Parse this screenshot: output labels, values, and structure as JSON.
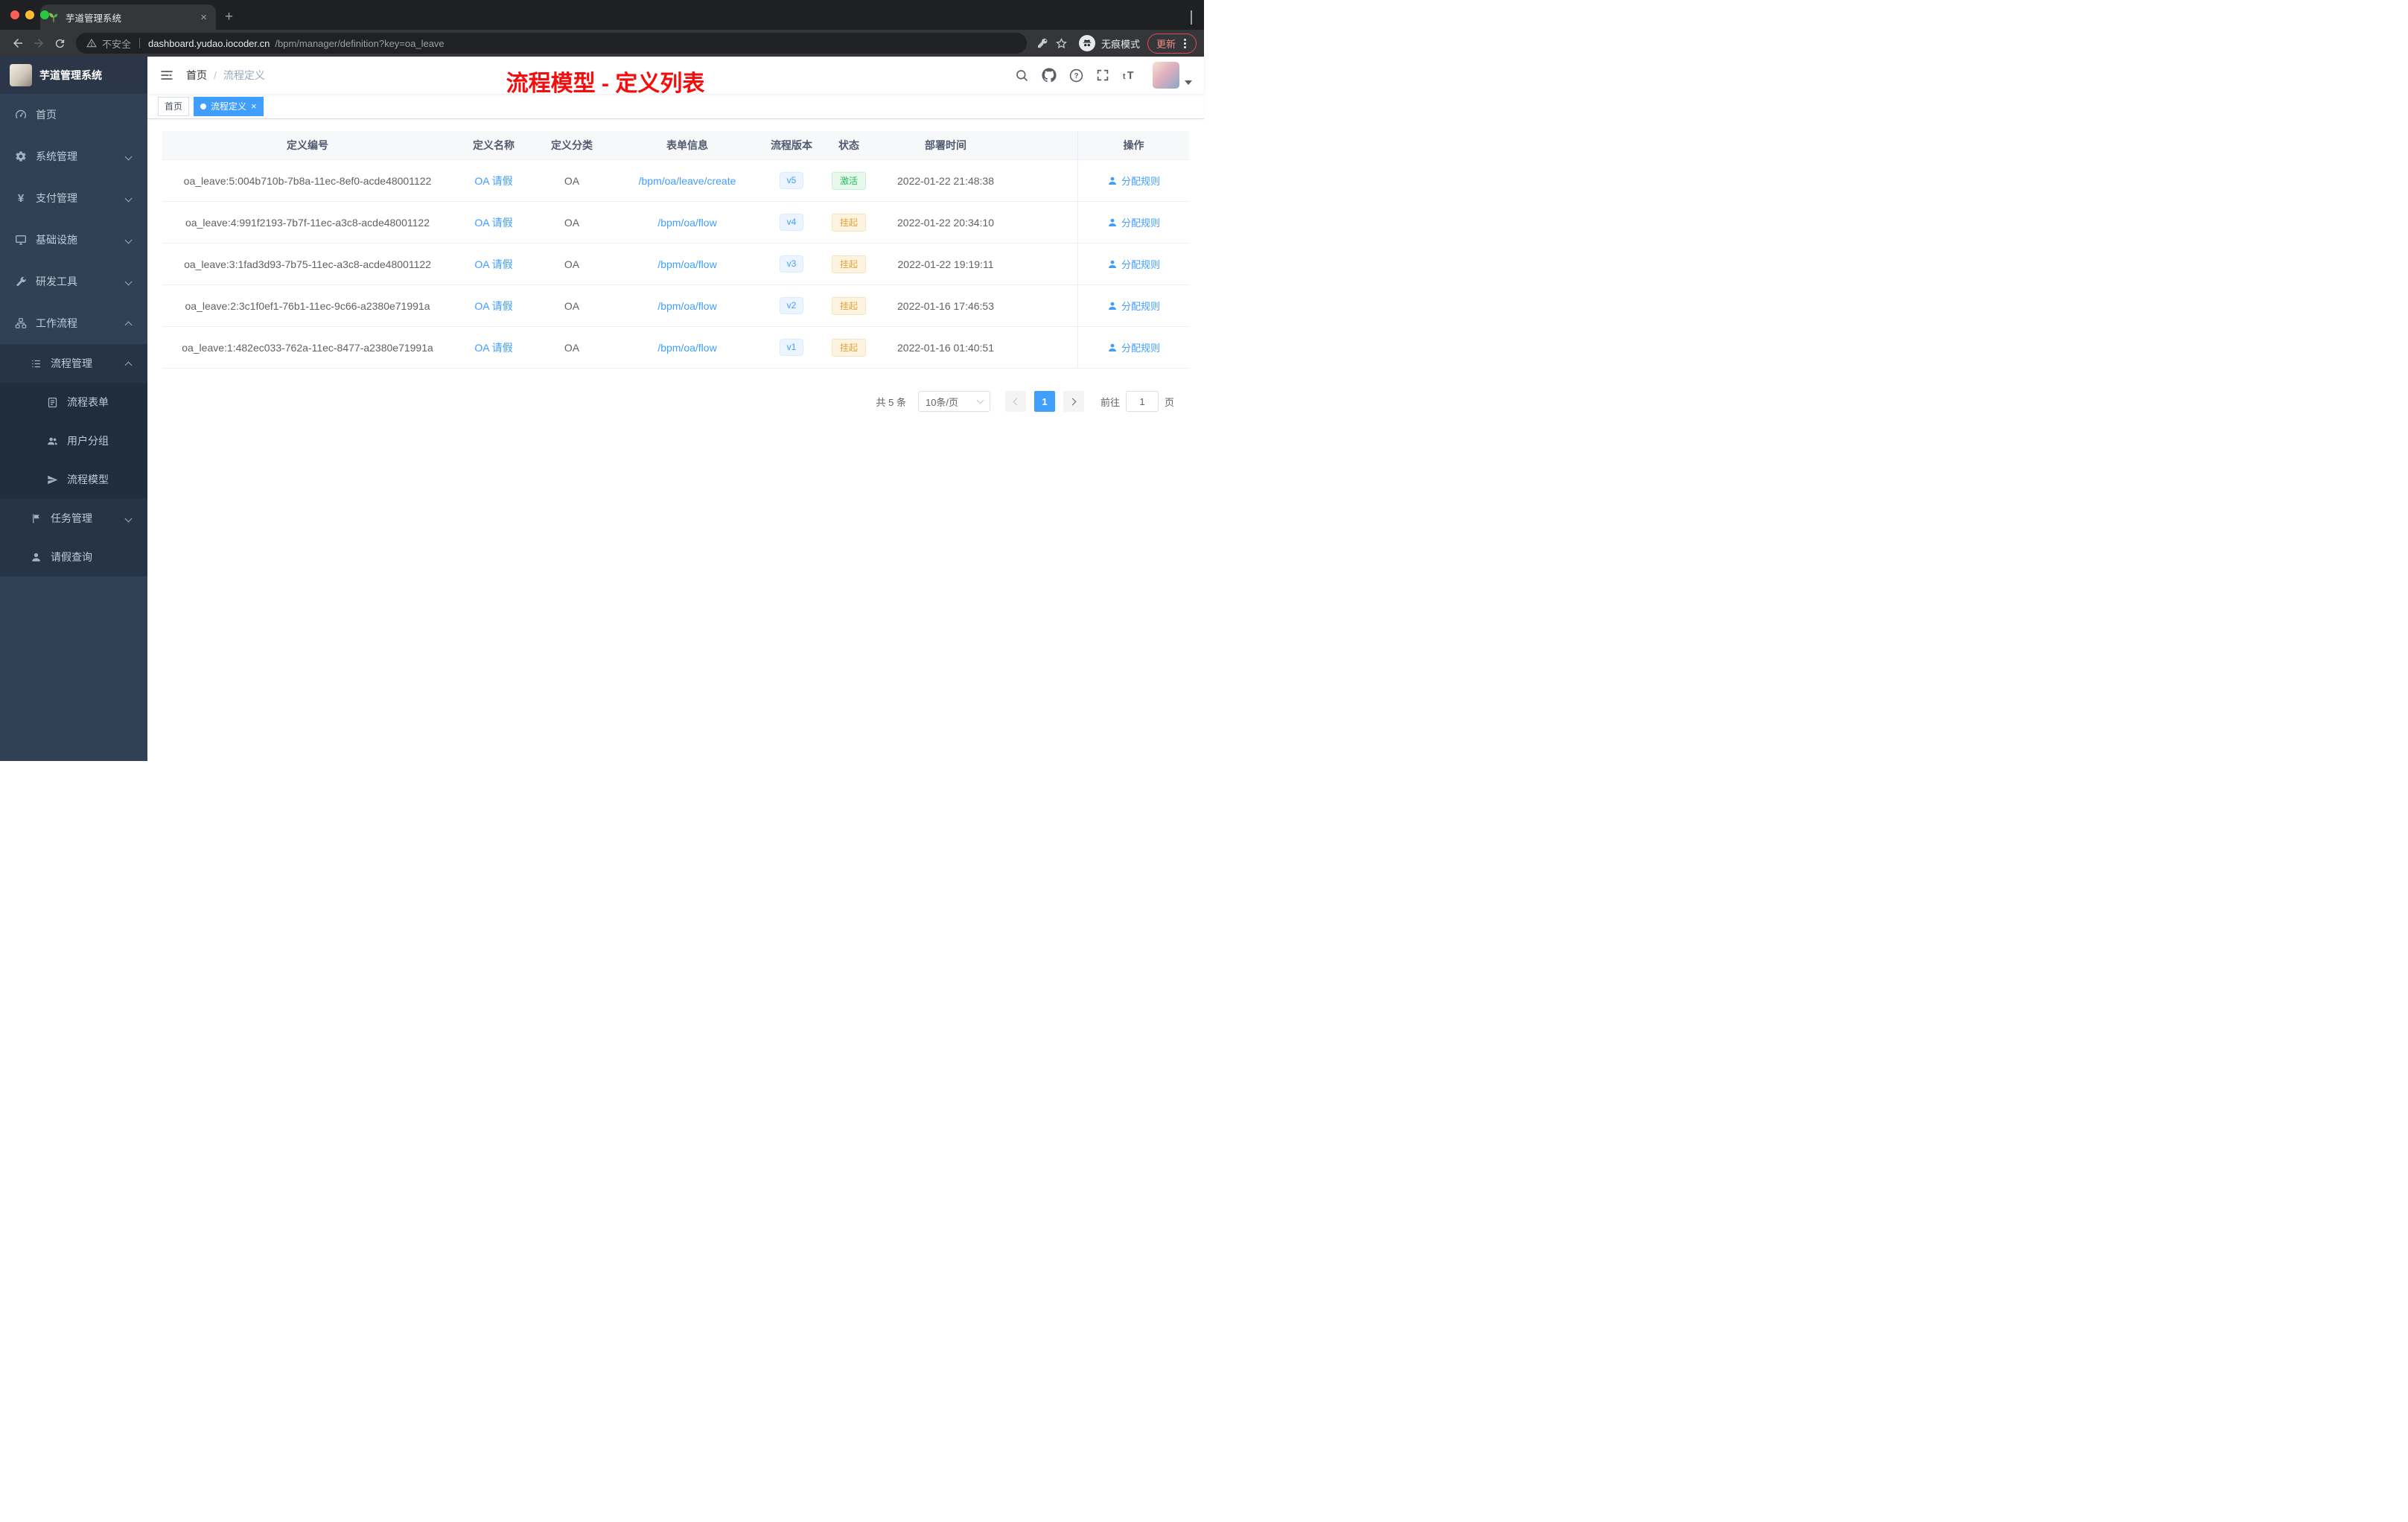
{
  "browser": {
    "tab": {
      "title": "芋道管理系统"
    },
    "address": {
      "security_label": "不安全",
      "host": "dashboard.yudao.iocoder.cn",
      "path": "/bpm/manager/definition?key=oa_leave"
    },
    "incognito_label": "无痕模式",
    "update_label": "更新"
  },
  "sidebar": {
    "logo_title": "芋道管理系统",
    "items": [
      {
        "label": "首页"
      },
      {
        "label": "系统管理"
      },
      {
        "label": "支付管理"
      },
      {
        "label": "基础设施"
      },
      {
        "label": "研发工具"
      },
      {
        "label": "工作流程"
      },
      {
        "label": "流程管理"
      },
      {
        "label": "流程表单"
      },
      {
        "label": "用户分组"
      },
      {
        "label": "流程模型"
      },
      {
        "label": "任务管理"
      },
      {
        "label": "请假查询"
      }
    ]
  },
  "navbar": {
    "breadcrumb_home": "首页",
    "breadcrumb_sep": "/",
    "breadcrumb_current": "流程定义"
  },
  "annotation": {
    "title": "流程模型 - 定义列表"
  },
  "tags": [
    {
      "label": "首页",
      "active": false
    },
    {
      "label": "流程定义",
      "active": true
    }
  ],
  "table": {
    "columns": [
      "定义编号",
      "定义名称",
      "定义分类",
      "表单信息",
      "流程版本",
      "状态",
      "部署时间",
      "操作"
    ],
    "rows": [
      {
        "id": "oa_leave:5:004b710b-7b8a-11ec-8ef0-acde48001122",
        "name": "OA 请假",
        "category": "OA",
        "form": "/bpm/oa/leave/create",
        "version": "v5",
        "status": "激活",
        "status_type": "success",
        "deployed_at": "2022-01-22 21:48:38",
        "action": "分配规则"
      },
      {
        "id": "oa_leave:4:991f2193-7b7f-11ec-a3c8-acde48001122",
        "name": "OA 请假",
        "category": "OA",
        "form": "/bpm/oa/flow",
        "version": "v4",
        "status": "挂起",
        "status_type": "warning",
        "deployed_at": "2022-01-22 20:34:10",
        "action": "分配规则"
      },
      {
        "id": "oa_leave:3:1fad3d93-7b75-11ec-a3c8-acde48001122",
        "name": "OA 请假",
        "category": "OA",
        "form": "/bpm/oa/flow",
        "version": "v3",
        "status": "挂起",
        "status_type": "warning",
        "deployed_at": "2022-01-22 19:19:11",
        "action": "分配规则"
      },
      {
        "id": "oa_leave:2:3c1f0ef1-76b1-11ec-9c66-a2380e71991a",
        "name": "OA 请假",
        "category": "OA",
        "form": "/bpm/oa/flow",
        "version": "v2",
        "status": "挂起",
        "status_type": "warning",
        "deployed_at": "2022-01-16 17:46:53",
        "action": "分配规则"
      },
      {
        "id": "oa_leave:1:482ec033-762a-11ec-8477-a2380e71991a",
        "name": "OA 请假",
        "category": "OA",
        "form": "/bpm/oa/flow",
        "version": "v1",
        "status": "挂起",
        "status_type": "warning",
        "deployed_at": "2022-01-16 01:40:51",
        "action": "分配规则"
      }
    ]
  },
  "pagination": {
    "total": "共 5 条",
    "page_size": "10条/页",
    "current_page": "1",
    "goto_label": "前往",
    "goto_value": "1",
    "page_unit": "页"
  },
  "colors": {
    "accent_blue": "#409eff",
    "success_green": "#1fbf5c",
    "warning_orange": "#e6a23c",
    "annotation_red": "#f50d0d",
    "sidebar_bg": "#304156"
  }
}
